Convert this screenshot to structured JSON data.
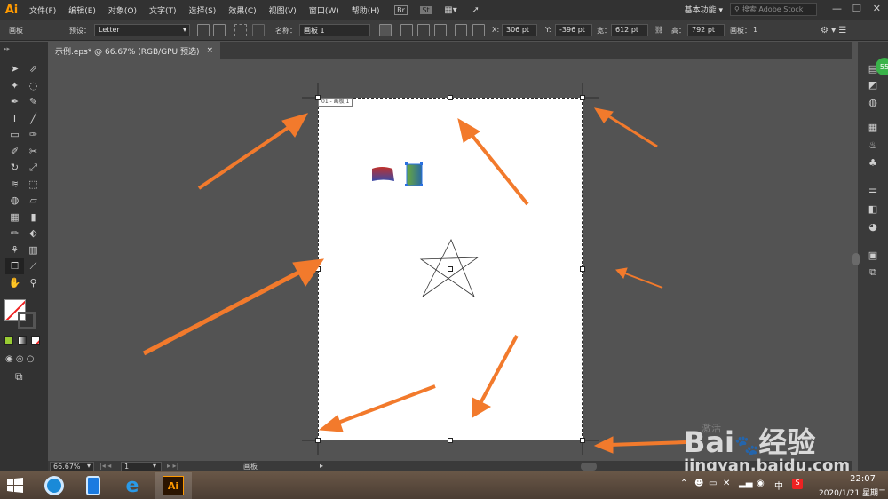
{
  "app": {
    "logo": "Ai"
  },
  "menu": [
    "文件(F)",
    "编辑(E)",
    "对象(O)",
    "文字(T)",
    "选择(S)",
    "效果(C)",
    "视图(V)",
    "窗口(W)",
    "帮助(H)"
  ],
  "toolbar_icons": {
    "bridge": "Br",
    "stock": "St"
  },
  "workspace": {
    "label": "基本功能"
  },
  "search": {
    "placeholder": "搜索 Adobe Stock"
  },
  "control_bar": {
    "context_label": "画板",
    "preset_label": "预设：",
    "preset_value": "Letter",
    "name_label": "名称：",
    "name_value": "画板 1",
    "x_label": "X:",
    "x_value": "306 pt",
    "y_label": "Y:",
    "y_value": "-396 pt",
    "w_label": "宽：",
    "w_value": "612 pt",
    "h_label": "高：",
    "h_value": "792 pt",
    "artboards_label": "画板：",
    "artboards_value": "1"
  },
  "document": {
    "tab_title": "示例.eps* @ 66.67% (RGB/GPU 预选)",
    "close": "×"
  },
  "artboard": {
    "label": "01 - 画板 1"
  },
  "status_bar": {
    "zoom": "66.67%",
    "page": "1",
    "tool_label": "画板"
  },
  "colors": {
    "menubar": "#323232",
    "panel": "#3c3c3c",
    "canvas": "#535353",
    "arrow": "#f27a2c",
    "ai_brand": "#ff9a00"
  },
  "watermark": {
    "text_big": "Bai",
    "text_big_2": "经验",
    "text_small": "jingyan.baidu.com",
    "faint": "激活"
  },
  "taskbar": {
    "apps": [
      "edge-icon",
      "phone-icon",
      "ie-icon",
      "illustrator-icon"
    ],
    "ime": "中",
    "time": "22:07",
    "date": "2020/1/21 星期二"
  },
  "badge": {
    "value": "55"
  }
}
